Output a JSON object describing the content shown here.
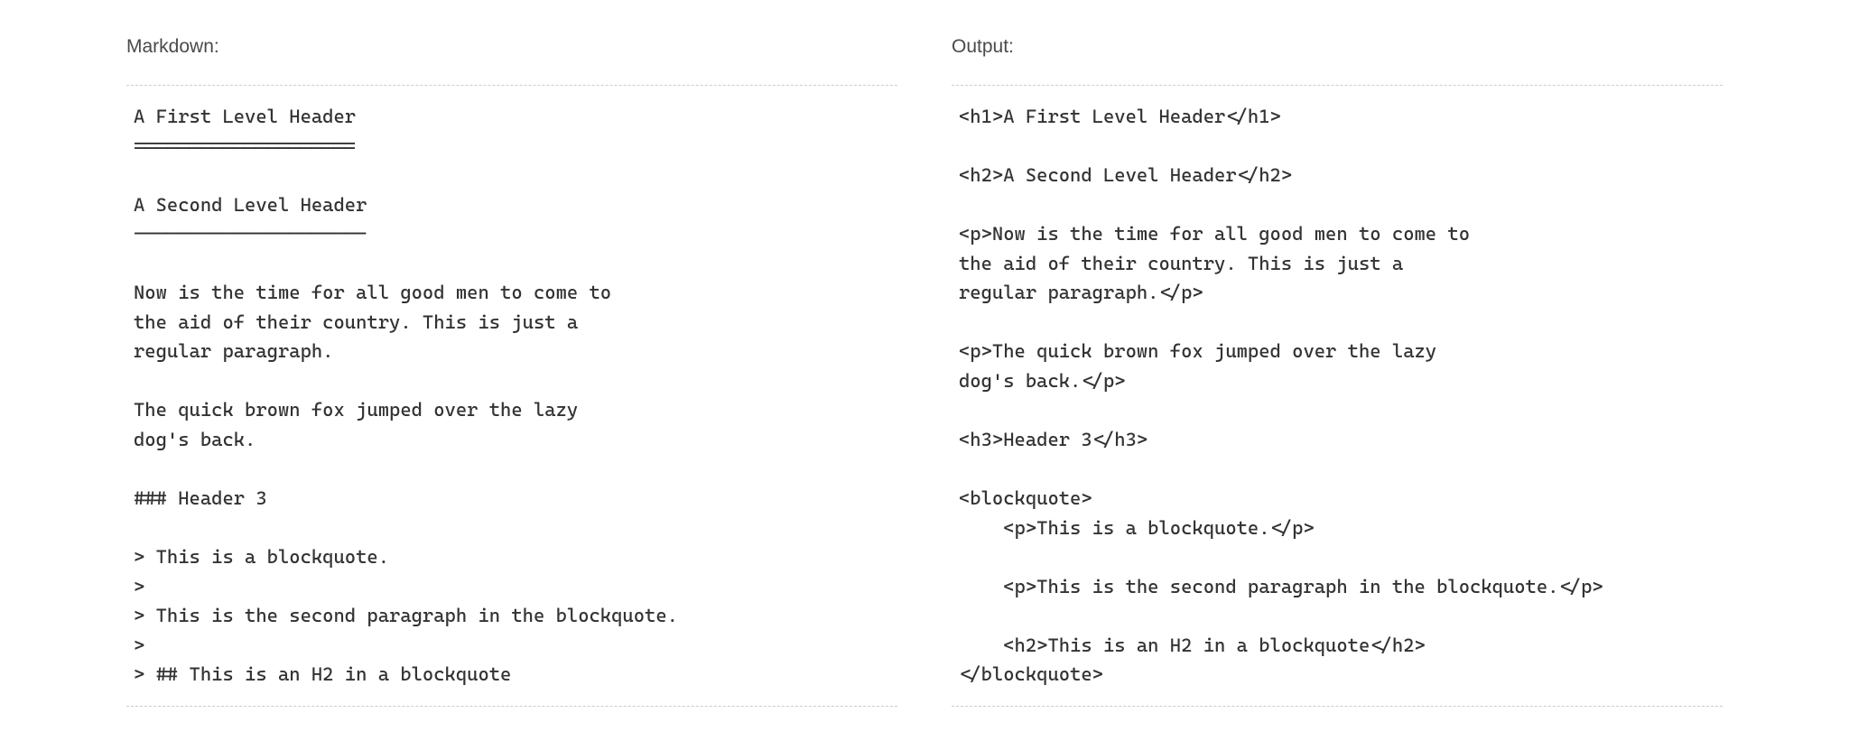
{
  "left": {
    "label": "Markdown:",
    "code": "A First Level Header\n====================\n\nA Second Level Header\n---------------------\n\nNow is the time for all good men to come to\nthe aid of their country. This is just a\nregular paragraph.\n\nThe quick brown fox jumped over the lazy\ndog's back.\n\n### Header 3\n\n> This is a blockquote.\n> \n> This is the second paragraph in the blockquote.\n>\n> ## This is an H2 in a blockquote"
  },
  "right": {
    "label": "Output:",
    "code": "<h1>A First Level Header</h1>\n\n<h2>A Second Level Header</h2>\n\n<p>Now is the time for all good men to come to\nthe aid of their country. This is just a\nregular paragraph.</p>\n\n<p>The quick brown fox jumped over the lazy\ndog's back.</p>\n\n<h3>Header 3</h3>\n\n<blockquote>\n    <p>This is a blockquote.</p>\n\n    <p>This is the second paragraph in the blockquote.</p>\n\n    <h2>This is an H2 in a blockquote</h2>\n</blockquote>"
  }
}
